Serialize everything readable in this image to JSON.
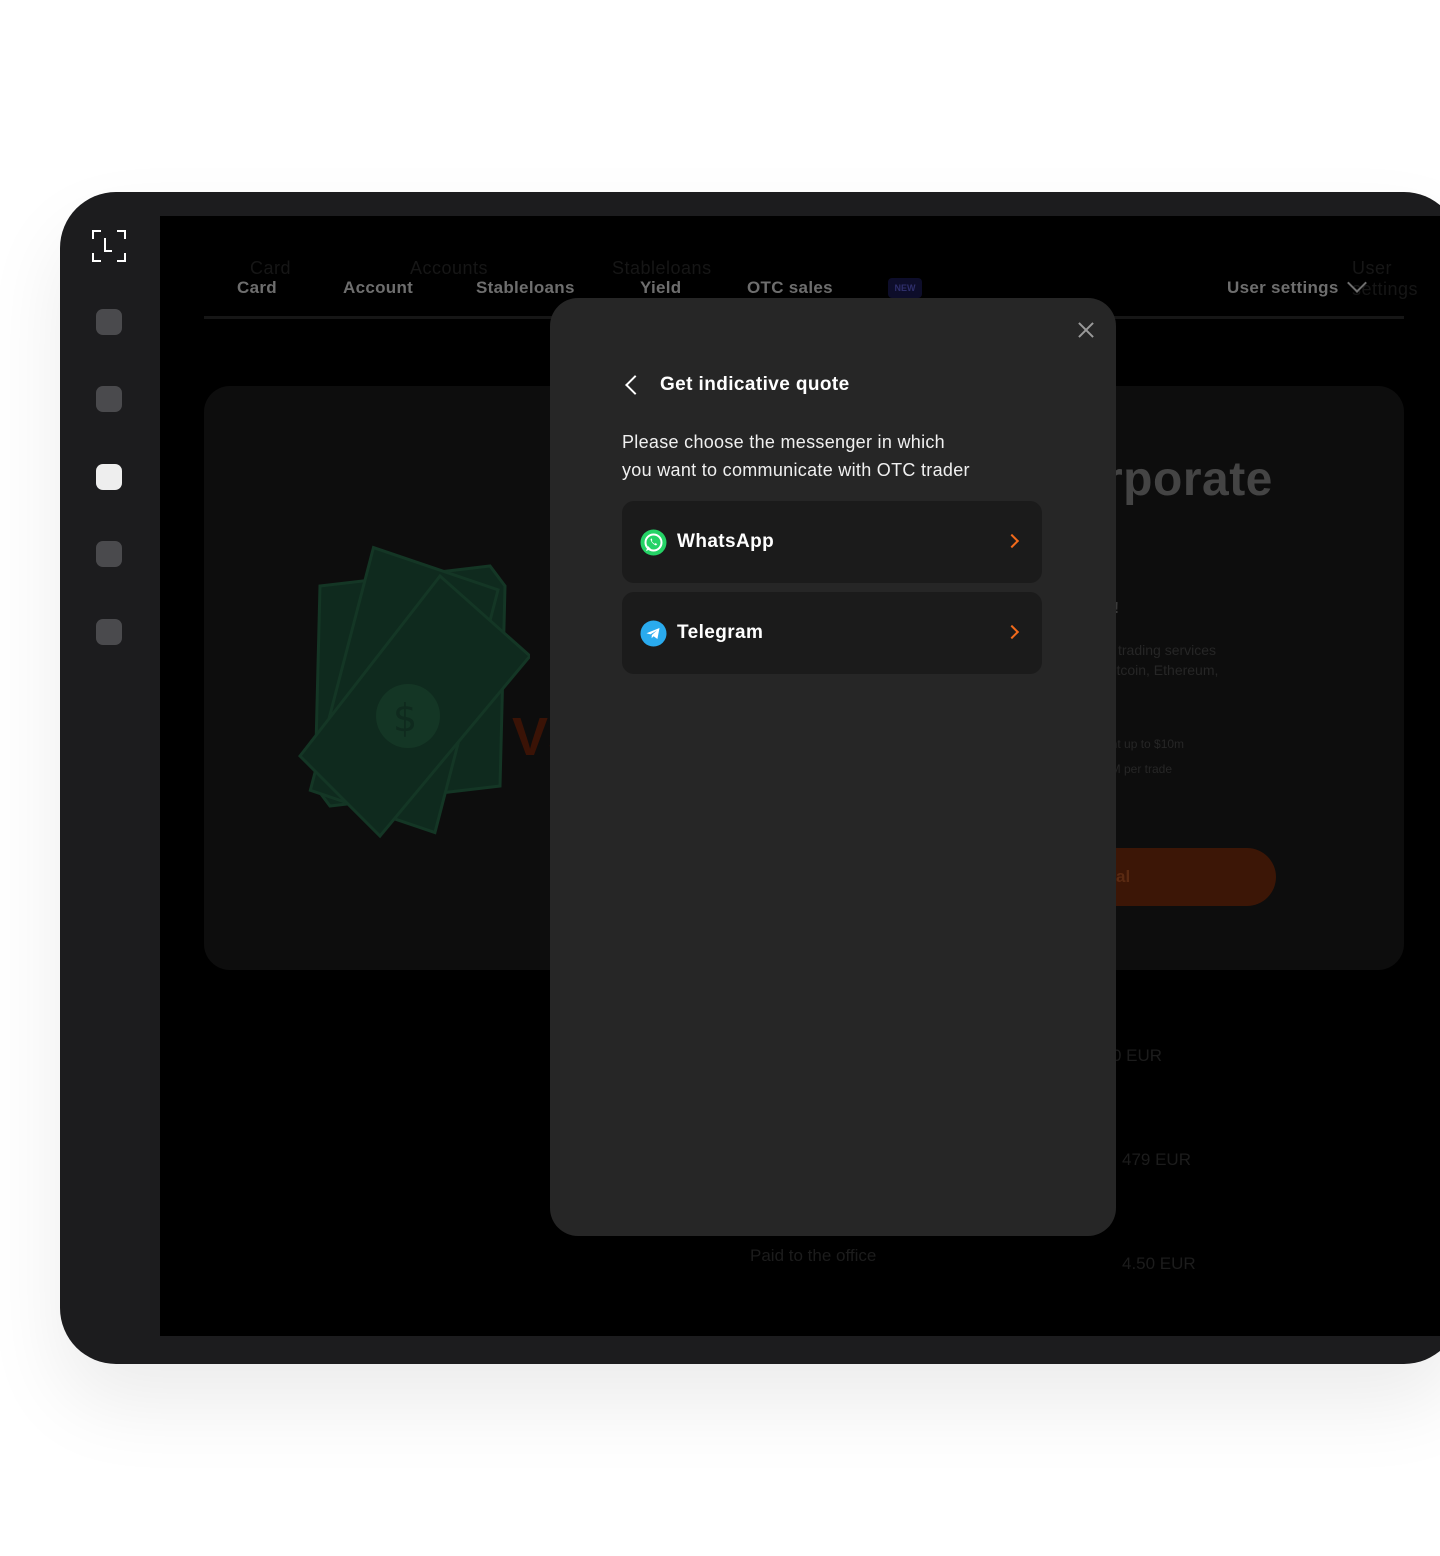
{
  "nav": {
    "ghost_items": [
      "Card",
      "Accounts",
      "Stableloans",
      "User settings"
    ],
    "items": [
      "Card",
      "Account",
      "Stableloans",
      "Yield",
      "OTC sales"
    ],
    "badge": "NEW",
    "user_settings": "User settings"
  },
  "hero": {
    "vs": "VS",
    "heading": "rporate",
    "lines": [
      "o!",
      "C trading services",
      "Bitcoin, Ethereum,",
      "s",
      "ent up to $10m",
      "0M per trade"
    ],
    "cta": "al"
  },
  "bottom": {
    "left": "Paid to the office",
    "rows": [
      "0 EUR",
      "479 EUR",
      "4.50 EUR"
    ]
  },
  "modal": {
    "back_title": "Get indicative quote",
    "description_line1": "Please choose the messenger in which",
    "description_line2": "you want to communicate with OTC trader",
    "options": [
      {
        "label": "WhatsApp",
        "icon": "whatsapp-icon",
        "color": "#25D366"
      },
      {
        "label": "Telegram",
        "icon": "telegram-icon",
        "color": "#2AABEE"
      }
    ]
  },
  "colors": {
    "accent": "#f26a1b",
    "modal_bg": "#262626",
    "option_bg": "#1b1b1b"
  }
}
